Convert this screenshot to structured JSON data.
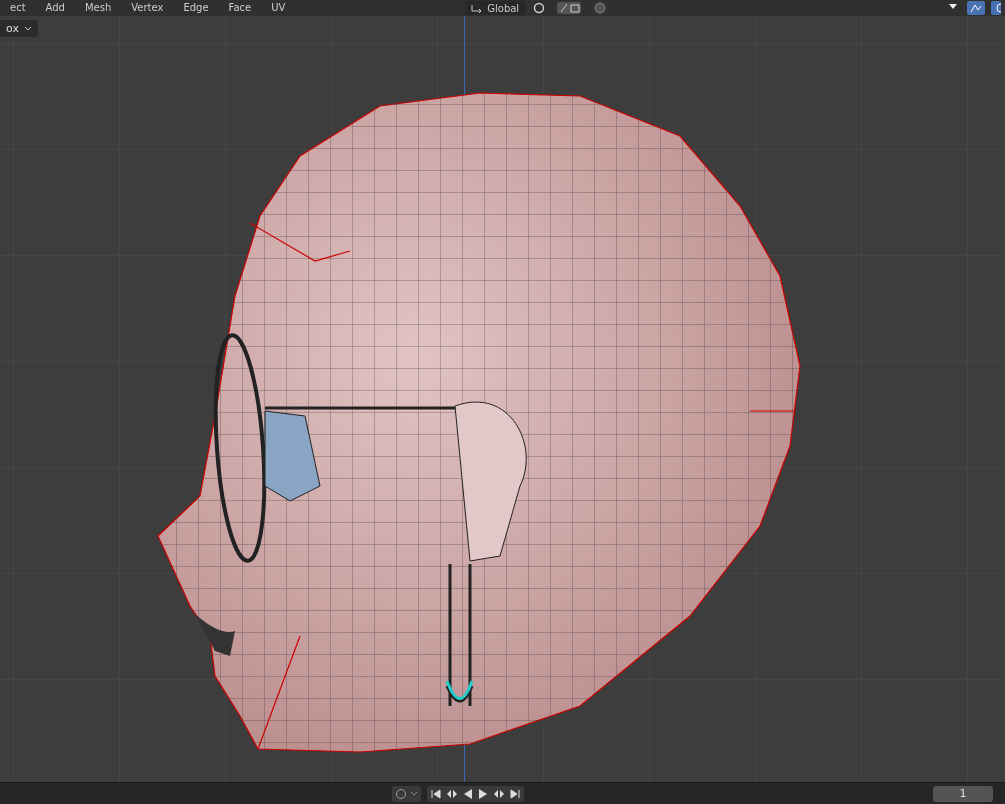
{
  "header": {
    "menus": [
      "ect",
      "Add",
      "Mesh",
      "Vertex",
      "Edge",
      "Face",
      "UV"
    ],
    "orientation": "Global"
  },
  "viewport": {
    "select_mode": "ox"
  },
  "timeline": {
    "current_frame": "1"
  }
}
